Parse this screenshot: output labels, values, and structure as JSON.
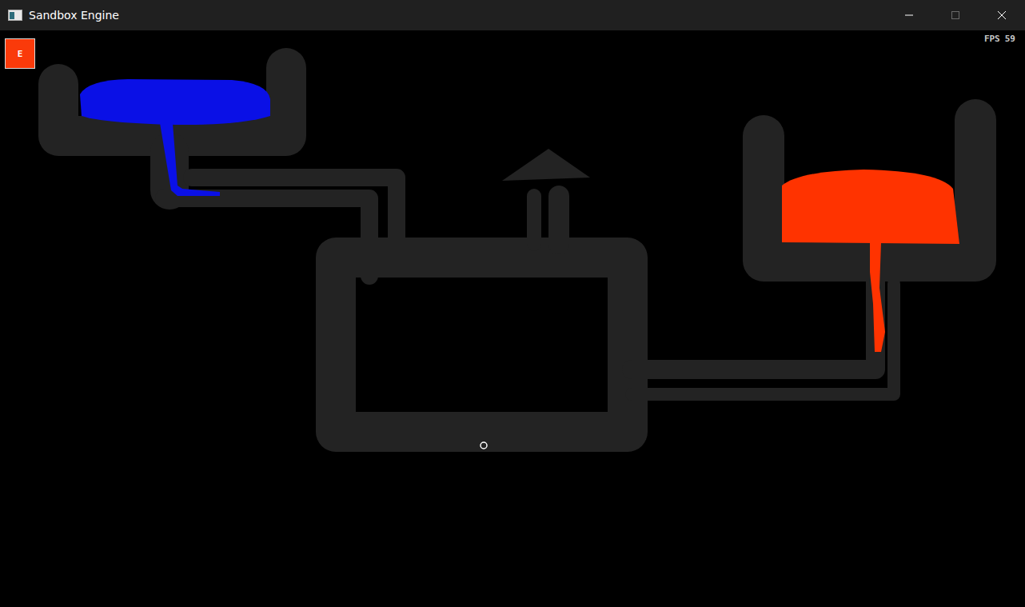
{
  "window": {
    "title": "Sandbox Engine"
  },
  "element_button": {
    "label": "E",
    "color": "#fa3a0a"
  },
  "fps": {
    "label": "FPS",
    "value": "59"
  },
  "fluids": [
    {
      "color": "#0a10e6"
    },
    {
      "color": "#ff3300"
    }
  ]
}
